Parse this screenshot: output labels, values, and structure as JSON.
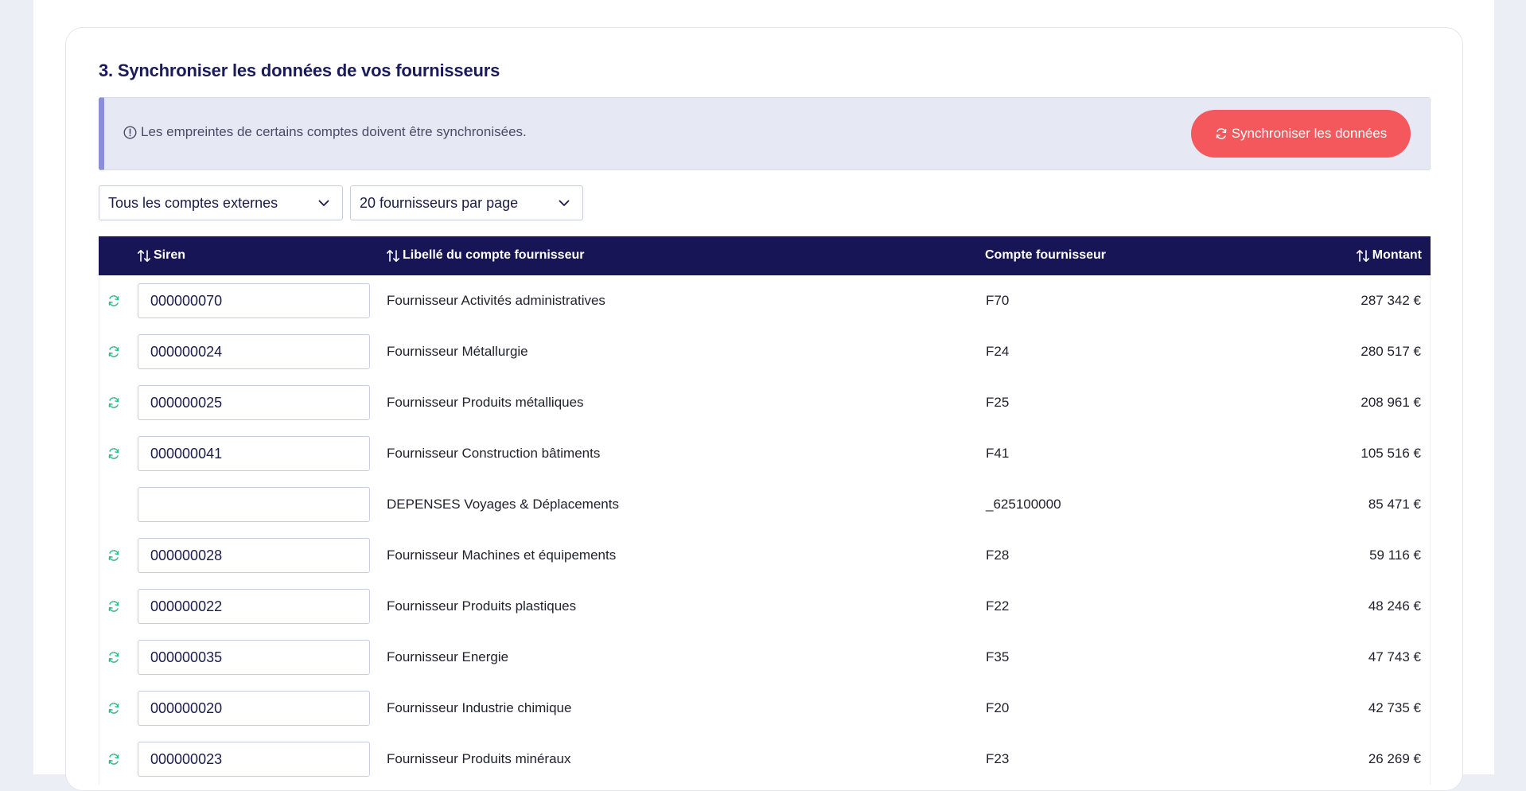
{
  "section": {
    "title": "3. Synchroniser les données de vos fournisseurs"
  },
  "alert": {
    "icon": "info-circle-icon",
    "message": "Les empreintes de certains comptes doivent être synchronisées.",
    "button_label": "Synchroniser les données",
    "button_icon": "refresh-icon"
  },
  "filters": {
    "accounts_value": "Tous les comptes externes",
    "per_page_value": "20 fournisseurs par page"
  },
  "table": {
    "columns": {
      "siren": "Siren",
      "libelle": "Libellé du compte fournisseur",
      "compte": "Compte fournisseur",
      "montant": "Montant"
    },
    "rows": [
      {
        "synced": true,
        "siren": "000000070",
        "libelle": "Fournisseur Activités administratives",
        "compte": "F70",
        "montant": "287 342 €"
      },
      {
        "synced": true,
        "siren": "000000024",
        "libelle": "Fournisseur Métallurgie",
        "compte": "F24",
        "montant": "280 517 €"
      },
      {
        "synced": true,
        "siren": "000000025",
        "libelle": "Fournisseur Produits métalliques",
        "compte": "F25",
        "montant": "208 961 €"
      },
      {
        "synced": true,
        "siren": "000000041",
        "libelle": "Fournisseur Construction bâtiments",
        "compte": "F41",
        "montant": "105 516 €"
      },
      {
        "synced": false,
        "siren": "",
        "libelle": "DEPENSES Voyages & Déplacements",
        "compte": "_625100000",
        "montant": "85 471 €"
      },
      {
        "synced": true,
        "siren": "000000028",
        "libelle": "Fournisseur Machines et équipements",
        "compte": "F28",
        "montant": "59 116 €"
      },
      {
        "synced": true,
        "siren": "000000022",
        "libelle": "Fournisseur Produits plastiques",
        "compte": "F22",
        "montant": "48 246 €"
      },
      {
        "synced": true,
        "siren": "000000035",
        "libelle": "Fournisseur Energie",
        "compte": "F35",
        "montant": "47 743 €"
      },
      {
        "synced": true,
        "siren": "000000020",
        "libelle": "Fournisseur Industrie chimique",
        "compte": "F20",
        "montant": "42 735 €"
      },
      {
        "synced": true,
        "siren": "000000023",
        "libelle": "Fournisseur Produits minéraux",
        "compte": "F23",
        "montant": "26 269 €"
      }
    ]
  },
  "colors": {
    "accent_red": "#f4575c",
    "header_navy": "#181556",
    "sync_green": "#2fbf86",
    "alert_border": "#8b8fd8"
  }
}
